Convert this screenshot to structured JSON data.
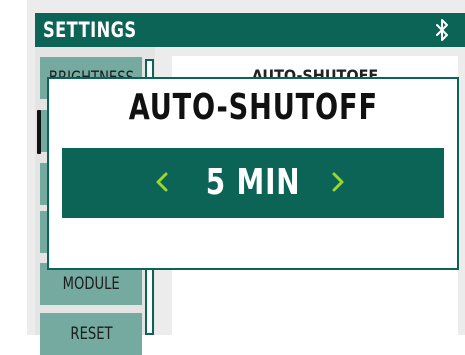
{
  "header": {
    "title": "SETTINGS",
    "bluetooth_icon": "bluetooth-icon"
  },
  "sidebar": {
    "items": [
      {
        "label": "BRIGHTNESS"
      },
      {
        "label": ""
      },
      {
        "label": ""
      },
      {
        "label": ""
      },
      {
        "label": "MODULE"
      },
      {
        "label": "RESET"
      }
    ]
  },
  "content": {
    "title": "AUTO-SHUTOFF",
    "note": ""
  },
  "modal": {
    "title": "AUTO-SHUTOFF",
    "value": "5 MIN",
    "decrease_icon": "chevron-left-icon",
    "increase_icon": "chevron-right-icon"
  },
  "colors": {
    "primary": "#0c6457",
    "accent": "#9bd62a",
    "sidebar_item": "#74aaa0"
  }
}
